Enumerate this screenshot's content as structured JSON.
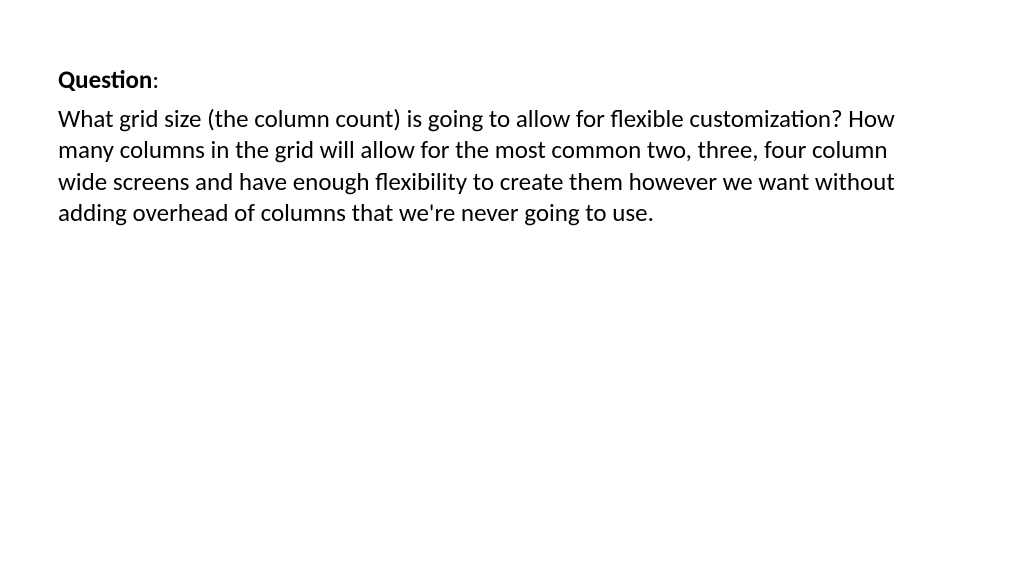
{
  "heading": {
    "label": "Question",
    "separator": ":"
  },
  "body": "What grid size (the column count) is going to allow for flexible customization? How many columns in the grid will allow for the most common two, three, four column wide screens and have enough flexibility to create them however we want without adding overhead of columns that we're never going to use."
}
